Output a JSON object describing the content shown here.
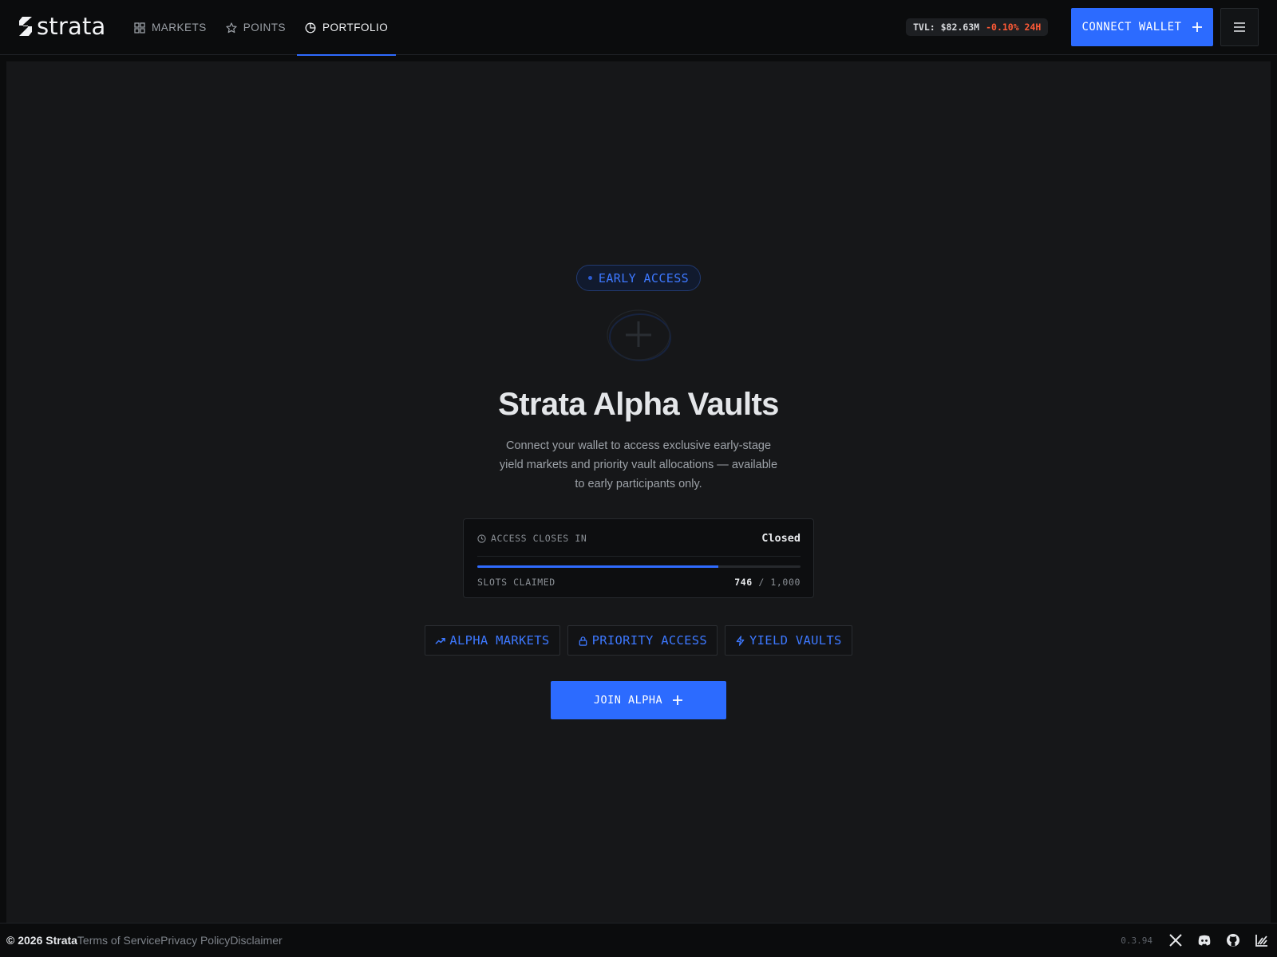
{
  "brand": {
    "name": "strata"
  },
  "nav": {
    "items": [
      {
        "label": "MARKETS",
        "icon": "grid-icon",
        "active": false
      },
      {
        "label": "POINTS",
        "icon": "star-icon",
        "active": false
      },
      {
        "label": "PORTFOLIO",
        "icon": "pie-chart-icon",
        "active": true
      }
    ]
  },
  "header": {
    "tvl_label": "TVL: $82.63M",
    "tvl_change": "-0.10% 24H",
    "connect_label": "CONNECT WALLET",
    "menu_icon": "hamburger-icon"
  },
  "hero": {
    "badge": "EARLY ACCESS",
    "title": "Strata Alpha Vaults",
    "subtitle": "Connect your wallet to access exclusive early-stage yield markets and priority vault allocations — available to early participants only."
  },
  "access_card": {
    "closes_label": "ACCESS CLOSES IN",
    "status": "Closed",
    "slots_label": "SLOTS CLAIMED",
    "slots_claimed": "746",
    "slots_sep": " / ",
    "slots_total": "1,000",
    "progress_fraction": 0.746
  },
  "features": [
    {
      "label": "ALPHA MARKETS",
      "icon": "trending-up-icon"
    },
    {
      "label": "PRIORITY ACCESS",
      "icon": "lock-icon"
    },
    {
      "label": "YIELD VAULTS",
      "icon": "lightning-icon"
    }
  ],
  "cta": {
    "join_label": "JOIN ALPHA"
  },
  "footer": {
    "copyright": "© 2026 Strata",
    "links": [
      "Terms of Service",
      "Privacy Policy",
      "Disclaimer"
    ],
    "version": "0.3.94",
    "social_icons": [
      "x-icon",
      "discord-icon",
      "github-icon",
      "chart-icon"
    ]
  },
  "colors": {
    "accent": "#2c6bff",
    "negative": "#ff5a36",
    "background": "#0b0c0d",
    "panel": "#161719"
  }
}
